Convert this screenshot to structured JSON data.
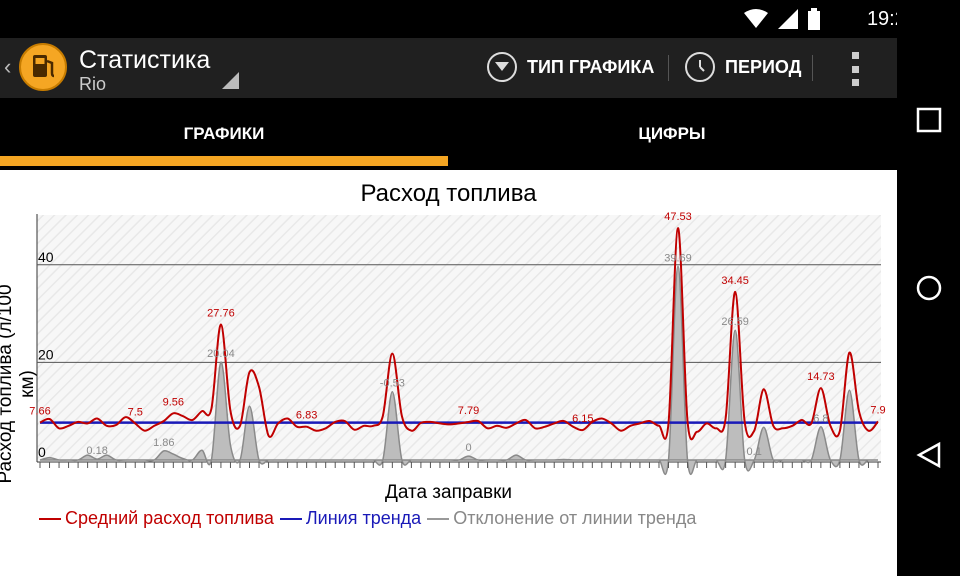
{
  "status_bar": {
    "time": "19:29"
  },
  "action_bar": {
    "title": "Статистика",
    "subtitle": "Rio",
    "chart_type_label": "ТИП ГРАФИКА",
    "period_label": "ПЕРИОД"
  },
  "tabs": [
    {
      "label": "ГРАФИКИ",
      "active": true
    },
    {
      "label": "ЦИФРЫ",
      "active": false
    }
  ],
  "colors": {
    "accent": "#f5a623",
    "avg": "#c00000",
    "trend": "#1a1ab8",
    "deviation": "#999999"
  },
  "chart_data": {
    "type": "line",
    "title": "Расход топлива",
    "xlabel": "Дата заправки",
    "ylabel": "Расход топлива (л/100 км)",
    "ylim": [
      0,
      50
    ],
    "yticks": [
      0,
      20,
      40
    ],
    "grid": true,
    "legend_position": "bottom",
    "x": [
      0,
      1,
      2,
      3,
      4,
      5,
      6,
      7,
      8,
      9,
      10,
      11,
      12,
      13,
      14,
      15,
      16,
      17,
      18,
      19,
      20,
      21,
      22,
      23,
      24,
      25,
      26,
      27,
      28,
      29,
      30,
      31,
      32,
      33,
      34,
      35,
      36,
      37,
      38,
      39,
      40,
      41,
      42,
      43,
      44,
      45,
      46,
      47,
      48,
      49,
      50,
      51,
      52,
      53,
      54,
      55,
      56,
      57,
      58,
      59,
      60,
      61,
      62,
      63,
      64,
      65,
      66,
      67,
      68,
      69,
      70,
      71,
      72,
      73,
      74,
      75,
      76,
      77,
      78,
      79,
      80,
      81,
      82,
      83,
      84,
      85,
      86,
      87,
      88,
      89,
      90,
      91,
      92,
      93,
      94,
      95,
      96,
      97,
      98,
      99,
      100
    ],
    "series": [
      {
        "name": "Средний расход топлива",
        "values": [
          7.66,
          8.4,
          6.5,
          7.0,
          7.8,
          7.5,
          8.5,
          7.0,
          7.2,
          8.8,
          7.5,
          6.0,
          7.0,
          8.0,
          9.56,
          9.0,
          8.2,
          10.0,
          10.5,
          27.76,
          10.0,
          7.0,
          18.0,
          15.0,
          5.0,
          7.5,
          8.5,
          6.8,
          6.83,
          6.0,
          6.5,
          7.8,
          8.0,
          6.2,
          7.0,
          7.0,
          9.0,
          21.8,
          9.0,
          6.0,
          7.6,
          7.8,
          7.5,
          7.3,
          7.5,
          7.79,
          8.0,
          6.5,
          7.0,
          6.6,
          7.5,
          8.2,
          6.5,
          6.8,
          7.5,
          8.0,
          6.8,
          6.15,
          7.8,
          8.5,
          7.5,
          6.0,
          7.0,
          7.5,
          8.0,
          7.0,
          7.5,
          47.53,
          8.0,
          5.8,
          7.5,
          6.5,
          8.5,
          34.45,
          7.8,
          6.0,
          14.5,
          7.0,
          6.5,
          7.0,
          8.2,
          7.5,
          14.73,
          7.0,
          6.0,
          22.0,
          10.0,
          6.0,
          7.9
        ],
        "labels": {
          "0": "7.66",
          "10": "7.5",
          "14": "9.56",
          "19": "27.76",
          "28": "6.83",
          "45": "7.79",
          "57": "6.15",
          "67": "47.53",
          "73": "34.45",
          "82": "14.73",
          "88": "7.9"
        }
      },
      {
        "name": "Линия тренда",
        "values": [
          7.66,
          7.66,
          7.66,
          7.66,
          7.66,
          7.66,
          7.66,
          7.66,
          7.66,
          7.66,
          7.66,
          7.66,
          7.66,
          7.66,
          7.66,
          7.66,
          7.66,
          7.66,
          7.66,
          7.66,
          7.66,
          7.66,
          7.66,
          7.66,
          7.66,
          7.66,
          7.66,
          7.66,
          7.66,
          7.66,
          7.66,
          7.66,
          7.66,
          7.66,
          7.66,
          7.66,
          7.66,
          7.66,
          7.66,
          7.66,
          7.66,
          7.66,
          7.66,
          7.66,
          7.66,
          7.66,
          7.66,
          7.66,
          7.66,
          7.66,
          7.66,
          7.66,
          7.66,
          7.66,
          7.66,
          7.66,
          7.66,
          7.66,
          7.66,
          7.66,
          7.66,
          7.66,
          7.66,
          7.66,
          7.66,
          7.66,
          7.66,
          7.66,
          7.66,
          7.66,
          7.66,
          7.66,
          7.66,
          7.66,
          7.66,
          7.66,
          7.66,
          7.66,
          7.66,
          7.66,
          7.66,
          7.66,
          7.66,
          7.66,
          7.66,
          7.66,
          7.66,
          7.66,
          7.66
        ]
      },
      {
        "name": "Отклонение от линии тренда",
        "values": [
          0,
          0.5,
          0,
          0,
          0,
          1.0,
          0.18,
          1.0,
          0,
          0,
          0,
          0,
          0,
          1.86,
          1.2,
          0.3,
          0,
          2.0,
          0,
          20.04,
          3.0,
          0,
          11.0,
          0,
          0,
          0,
          0,
          0,
          0,
          0,
          0,
          0,
          0,
          0,
          0,
          0,
          0,
          14.0,
          0,
          0,
          0,
          0,
          0,
          0,
          0,
          0.8,
          0,
          0,
          0,
          0,
          1.0,
          0,
          0,
          0,
          0,
          0.1,
          0,
          0,
          0,
          0,
          0,
          0,
          0,
          0,
          0,
          0,
          0,
          39.69,
          0,
          0,
          0,
          0,
          0,
          26.59,
          0,
          0,
          6.7,
          0,
          0,
          0,
          0,
          0,
          6.8,
          0,
          0,
          14.3,
          0,
          0,
          0
        ],
        "labels": {
          "6": "0.18",
          "13": "1.86",
          "19": "20.04",
          "37": "-0.53",
          "45": "0",
          "67": "39.69",
          "73": "26.59",
          "75": "0.1",
          "82": "6.8"
        }
      }
    ]
  }
}
